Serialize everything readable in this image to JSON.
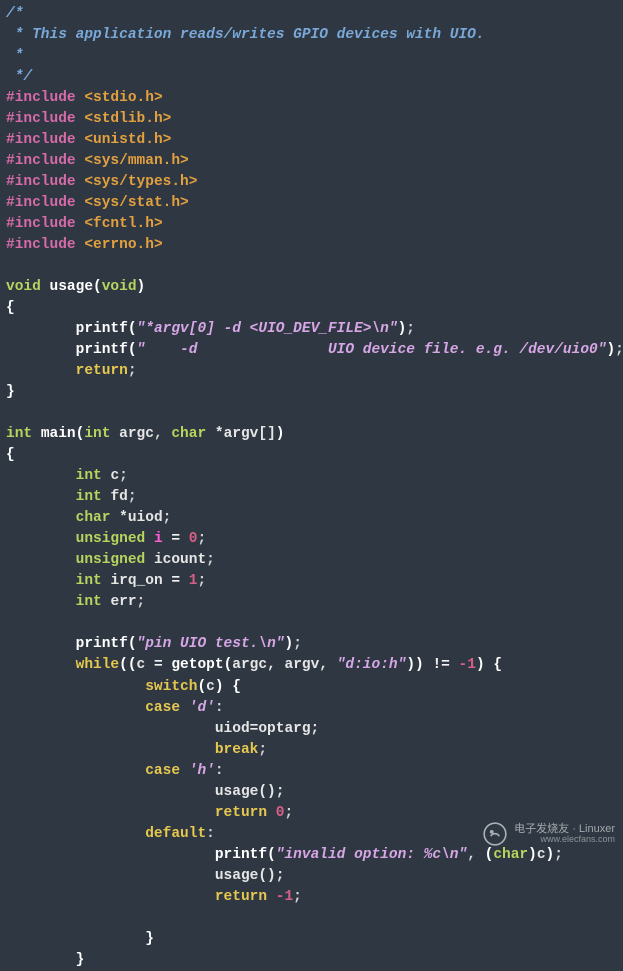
{
  "code": {
    "comment1": "/*",
    "comment2": " * This application reads/writes GPIO devices with UIO.",
    "comment3": " *",
    "comment4": " */",
    "inc_kw": "#include",
    "headers": [
      "<stdio.h>",
      "<stdlib.h>",
      "<unistd.h>",
      "<sys/mman.h>",
      "<sys/types.h>",
      "<sys/stat.h>",
      "<fcntl.h>",
      "<errno.h>"
    ],
    "kw_void": "void",
    "fn_usage": "usage",
    "kw_void2": "void",
    "printf": "printf",
    "usage_str1": "\"*argv[0] -d <UIO_DEV_FILE>\\n\"",
    "usage_str2": "\"    -d               UIO device file. e.g. /dev/uio0\"",
    "kw_return": "return",
    "kw_int": "int",
    "fn_main": "main",
    "param_argc": "argc",
    "kw_char": "char",
    "param_argv": "*argv[]",
    "decl_c": "c",
    "decl_fd": "fd",
    "decl_uiod": "*uiod",
    "kw_unsigned": "unsigned",
    "decl_i": "i",
    "eq": "=",
    "zero": "0",
    "decl_icount": "icount",
    "decl_irq_on": "irq_on",
    "one": "1",
    "decl_err": "err",
    "main_str1": "\"pin UIO test.\\n\"",
    "kw_while": "while",
    "getopt": "getopt",
    "getopt_args": "argc, argv, ",
    "getopt_str": "\"d:io:h\"",
    "neq": "!=",
    "neg1": "-1",
    "kw_switch": "switch",
    "kw_case": "case",
    "case_d": "'d'",
    "uiod_assign": "uiod=optarg;",
    "kw_break": "break",
    "case_h": "'h'",
    "call_usage": "usage();",
    "ret0": "0",
    "kw_default": "default",
    "invalid_str": "\"invalid option: %c\\n\"",
    "cast_char": "char",
    "var_c": "c",
    "retm1": "-1"
  },
  "watermark": {
    "brand": "电子发烧友",
    "site": "Linuxer",
    "url": "www.elecfans.com"
  }
}
